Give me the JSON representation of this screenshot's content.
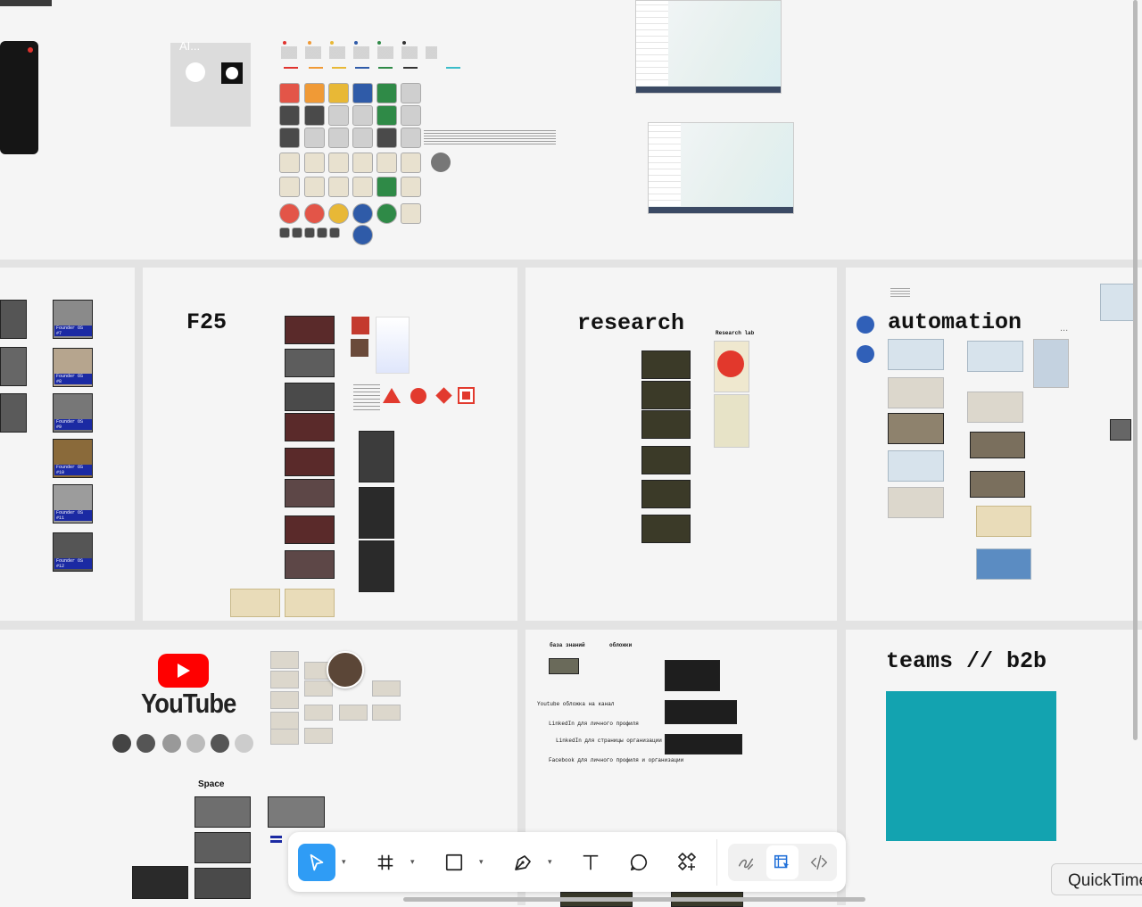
{
  "canvas": {
    "top_placeholder_label": "AI...",
    "frames": {
      "f25": {
        "title": "F25"
      },
      "research": {
        "title": "research",
        "research_lab_label": "Research lab"
      },
      "automation": {
        "title": "automation",
        "ellipsis": "..."
      },
      "youtube": {
        "logo_text": "YouTube",
        "space_label": "Space"
      },
      "knowledge": {
        "kb_label": "база знаний",
        "covers_label": "обложки",
        "yt_cover": "Youtube обложка на канал",
        "li_personal": "LinkedIn для личного профиля",
        "li_org": "LinkedIn для страницы организации",
        "fb_both": "Facebook для личного профиля и организации"
      },
      "teams": {
        "title": "teams // b2b",
        "accent_color": "#13a3b0"
      }
    },
    "founder_tags": [
      "Founder OS #7",
      "Founder OS #8",
      "Founder OS #9",
      "Founder OS #10",
      "Founder OS #11",
      "Founder OS #12"
    ]
  },
  "toolbar": {
    "tools": [
      {
        "name": "move-tool",
        "icon": "cursor-arrow-icon",
        "active": true
      },
      {
        "name": "frame-tool",
        "icon": "hash-frame-icon"
      },
      {
        "name": "shape-tool",
        "icon": "rectangle-icon"
      },
      {
        "name": "pen-tool",
        "icon": "pen-icon"
      },
      {
        "name": "text-tool",
        "icon": "text-T-icon"
      },
      {
        "name": "comment-tool",
        "icon": "speech-bubble-icon"
      },
      {
        "name": "actions-tool",
        "icon": "components-plus-icon"
      }
    ],
    "modes": [
      "draw-mode-icon",
      "design-mode-icon",
      "dev-mode-icon"
    ],
    "accent": "#2f9cf5"
  },
  "quicktime_label": "QuickTime"
}
